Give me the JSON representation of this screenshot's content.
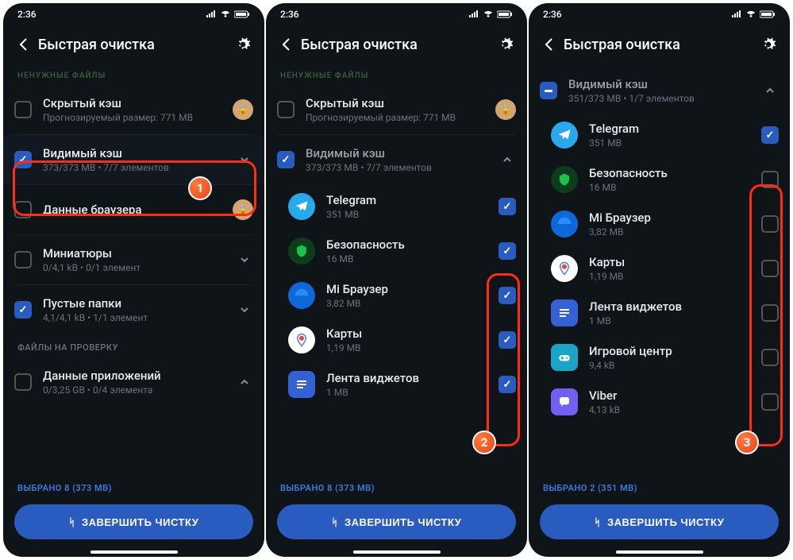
{
  "status": {
    "time": "2:36"
  },
  "header": {
    "title": "Быстрая очистка"
  },
  "sections": {
    "junk": "НЕНУЖНЫЕ ФАЙЛЫ",
    "review": "ФАЙЛЫ НА ПРОВЕРКУ"
  },
  "cats": {
    "hidden": {
      "title": "Скрытый кэш",
      "sub": "Прогнозируемый размер: 771 MB"
    },
    "visible": {
      "title": "Видимый кэш",
      "sub1": "373/373 MB • 7/7 элементов",
      "sub3": "351/373 MB • 1/7 элементов"
    },
    "browser": {
      "title": "Данные браузера"
    },
    "thumbs": {
      "title": "Миниатюры",
      "sub": "0/4,1 kB • 0/1 элемент"
    },
    "empty": {
      "title": "Пустые папки",
      "sub": "4,1/4,1 kB • 1/1 элемент"
    },
    "appdata": {
      "title": "Данные приложений",
      "sub": "0/3,25 GB • 0/4 элемента"
    }
  },
  "apps": {
    "tg": {
      "name": "Telegram",
      "size": "351 MB"
    },
    "sec": {
      "name": "Безопасность",
      "size": "16 MB"
    },
    "mi": {
      "name": "Mi Браузер",
      "size": "3,82 MB"
    },
    "maps": {
      "name": "Карты",
      "size": "1,19 MB"
    },
    "widg": {
      "name": "Лента виджетов",
      "size": "1 MB"
    },
    "game": {
      "name": "Игровой центр",
      "size": "9,4 kB"
    },
    "viber": {
      "name": "Viber",
      "size": "4,13 kB"
    }
  },
  "selected": {
    "p1": "ВЫБРАНО 8 (373 MB)",
    "p3": "ВЫБРАНО 2 (351 MB)"
  },
  "finish": "ЗАВЕРШИТЬ ЧИСТКУ"
}
